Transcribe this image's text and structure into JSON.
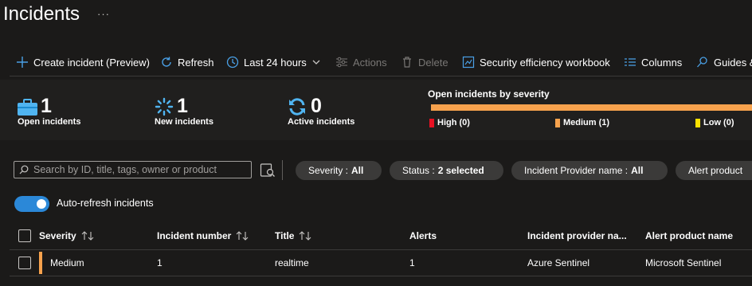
{
  "page": {
    "title": "Incidents",
    "more": "···"
  },
  "toolbar": {
    "create": "Create incident (Preview)",
    "refresh": "Refresh",
    "timerange": "Last 24 hours",
    "actions": "Actions",
    "delete": "Delete",
    "workbook": "Security efficiency workbook",
    "columns": "Columns",
    "guides": "Guides &"
  },
  "summary": {
    "open": {
      "count": "1",
      "label": "Open incidents"
    },
    "new": {
      "count": "1",
      "label": "New incidents"
    },
    "active": {
      "count": "0",
      "label": "Active incidents"
    },
    "severity": {
      "title": "Open incidents by severity",
      "high": "High (0)",
      "medium": "Medium (1)",
      "low": "Low (0)"
    }
  },
  "filters": {
    "search_placeholder": "Search by ID, title, tags, owner or product",
    "severity": {
      "label": "Severity :",
      "value": "All"
    },
    "status": {
      "label": "Status :",
      "value": "2 selected"
    },
    "provider": {
      "label": "Incident Provider name :",
      "value": "All"
    },
    "alert_product": {
      "label": "Alert product"
    }
  },
  "autorefresh": {
    "label": "Auto-refresh incidents",
    "enabled": true
  },
  "table": {
    "headers": {
      "severity": "Severity",
      "number": "Incident number",
      "title": "Title",
      "alerts": "Alerts",
      "provider": "Incident provider na...",
      "product": "Alert product name"
    },
    "rows": [
      {
        "severity": "Medium",
        "number": "1",
        "title": "realtime",
        "alerts": "1",
        "provider": "Azure Sentinel",
        "product": "Microsoft Sentinel"
      }
    ]
  },
  "colors": {
    "background": "#1b1a19",
    "accent": "#2b88d8",
    "high": "#e81123",
    "medium": "#f7a24d",
    "low": "#fce100"
  }
}
